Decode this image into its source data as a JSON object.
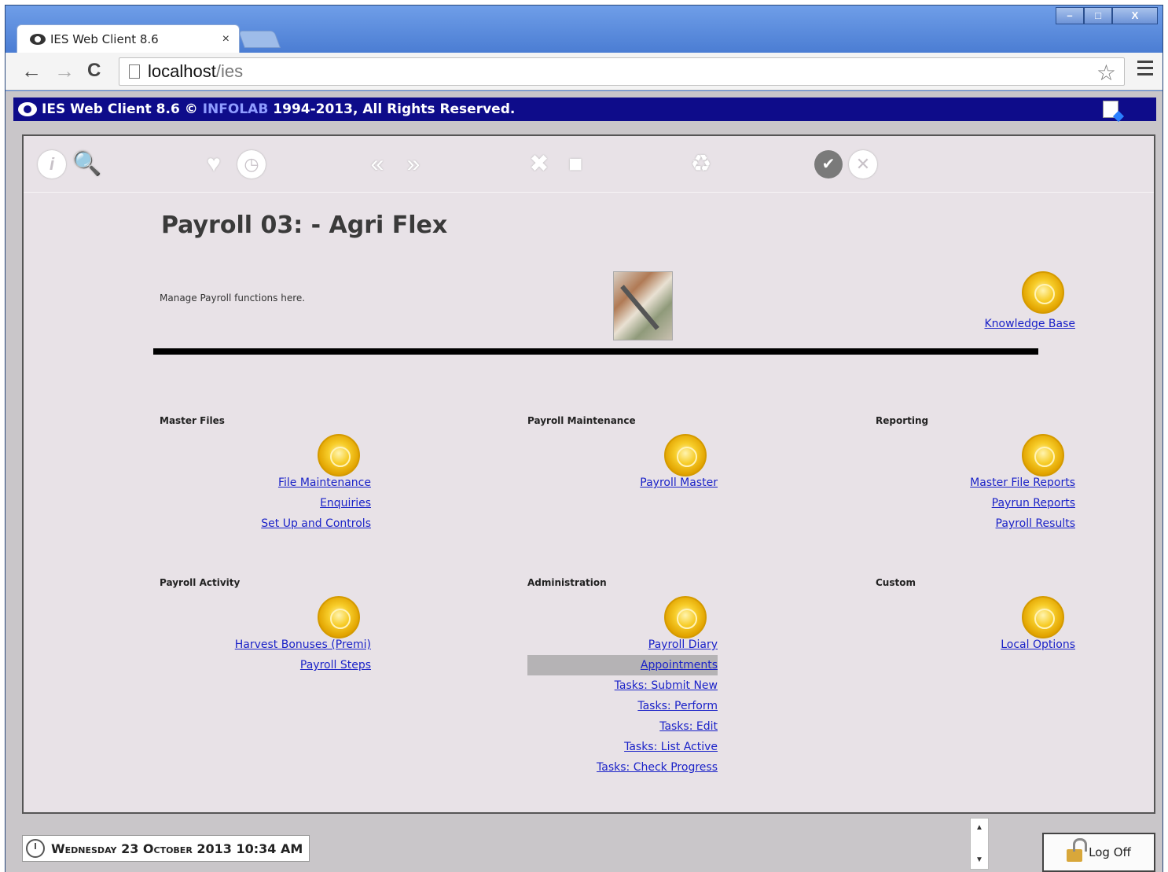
{
  "browser": {
    "tab_title": "IES Web Client 8.6",
    "tab_close": "×",
    "url_host": "localhost",
    "url_path": "/ies",
    "window_controls": {
      "minimize": "–",
      "maximize": "□",
      "close": "X"
    },
    "nav": {
      "back": "←",
      "forward": "→",
      "reload": "C",
      "star": "☆"
    }
  },
  "app": {
    "header": {
      "product": "IES Web Client 8.6",
      "copyright": "©",
      "company": "INFOLAB",
      "rights": "1994-2013, All Rights Reserved."
    },
    "toolbar_icons": [
      "info-icon",
      "search-icon",
      "favorite-heart-icon",
      "history-clock-icon",
      "previous-icon",
      "next-icon",
      "tools-icon",
      "document-icon",
      "recycle-icon",
      "confirm-check-icon",
      "cancel-x-icon"
    ],
    "toolbar_glyphs": {
      "info": "i",
      "search": "🔍",
      "heart": "♥",
      "clock": "◷",
      "prev": "«",
      "next": "»",
      "tools": "✖",
      "doc": "■",
      "recycle": "♻",
      "ok": "✔",
      "cancel": "✕"
    },
    "page_title": "Payroll 03: - Agri Flex",
    "description": "Manage Payroll functions here.",
    "knowledge_base": "Knowledge Base",
    "sections": {
      "master_files": {
        "title": "Master Files",
        "links": [
          "File Maintenance",
          "Enquiries",
          "Set Up and Controls"
        ]
      },
      "payroll_maintenance": {
        "title": "Payroll Maintenance",
        "links": [
          "Payroll Master"
        ]
      },
      "reporting": {
        "title": "Reporting",
        "links": [
          "Master File Reports",
          "Payrun Reports",
          "Payroll Results"
        ]
      },
      "payroll_activity": {
        "title": "Payroll Activity",
        "links": [
          "Harvest Bonuses (Premi)",
          "Payroll Steps"
        ]
      },
      "administration": {
        "title": "Administration",
        "links": [
          "Payroll Diary",
          "Appointments",
          "Tasks: Submit New",
          "Tasks: Perform",
          "Tasks: Edit",
          "Tasks: List Active",
          "Tasks: Check Progress"
        ]
      },
      "custom": {
        "title": "Custom",
        "links": [
          "Local Options"
        ]
      }
    },
    "status": {
      "datetime": "Wednesday 23 October 2013 10:34 AM",
      "logoff": "Log Off",
      "scroll_up": "▲",
      "scroll_down": "▼"
    }
  }
}
